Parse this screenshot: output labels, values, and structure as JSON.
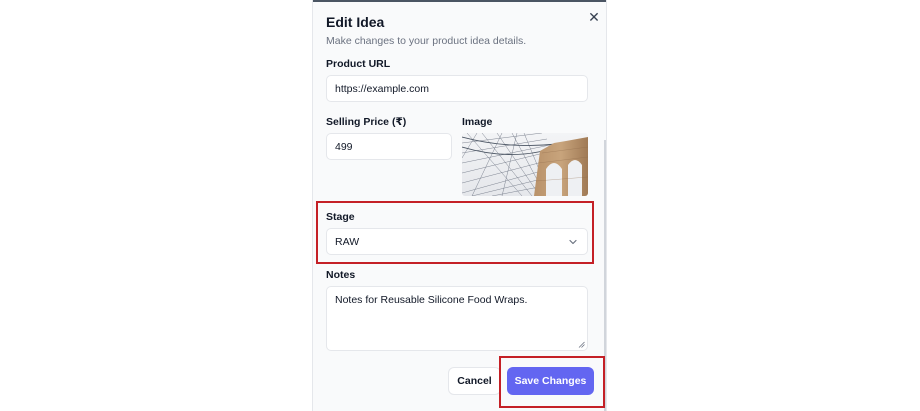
{
  "dialog": {
    "title": "Edit Idea",
    "subtitle": "Make changes to your product idea details.",
    "close_icon": "close-icon"
  },
  "fields": {
    "product_url": {
      "label": "Product URL",
      "value": "https://example.com"
    },
    "selling_price": {
      "label": "Selling Price (₹)",
      "value": "499"
    },
    "image": {
      "label": "Image",
      "content": "photo of bridge tower with suspension cables"
    },
    "stage": {
      "label": "Stage",
      "value": "RAW",
      "icon": "chevron-down-icon"
    },
    "notes": {
      "label": "Notes",
      "value": "Notes for Reusable Silicone Food Wraps."
    }
  },
  "actions": {
    "cancel_label": "Cancel",
    "save_label": "Save Changes"
  },
  "colors": {
    "primary": "#6366f1",
    "highlight": "#c42026",
    "dialog_bg": "#f9fafb"
  }
}
